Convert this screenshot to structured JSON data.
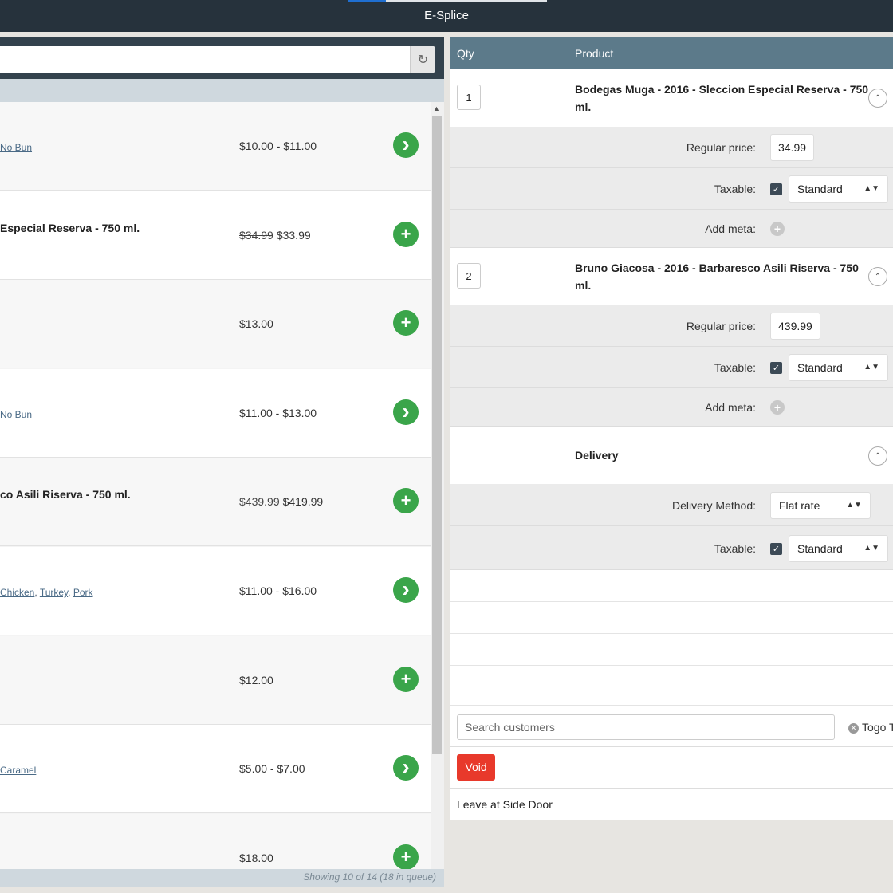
{
  "app": {
    "title": "E-Splice"
  },
  "products": {
    "rows": [
      {
        "name": "",
        "variants": [
          "No Bun"
        ],
        "price": "$10.00 - $11.00",
        "old_price": "",
        "action": "view"
      },
      {
        "name": "Especial Reserva - 750 ml.",
        "variants": [],
        "price": "$33.99",
        "old_price": "$34.99",
        "action": "add"
      },
      {
        "name": "",
        "variants": [],
        "price": "$13.00",
        "old_price": "",
        "action": "add"
      },
      {
        "name": "",
        "variants": [
          "No Bun"
        ],
        "price": "$11.00 - $13.00",
        "old_price": "",
        "action": "view"
      },
      {
        "name": "co Asili Riserva - 750 ml.",
        "variants": [],
        "price": "$419.99",
        "old_price": "$439.99",
        "action": "add"
      },
      {
        "name": "",
        "variants": [
          "Chicken",
          "Turkey",
          "Pork"
        ],
        "price": "$11.00 - $16.00",
        "old_price": "",
        "action": "view"
      },
      {
        "name": "",
        "variants": [],
        "price": "$12.00",
        "old_price": "",
        "action": "add"
      },
      {
        "name": "",
        "variants": [
          "Caramel"
        ],
        "price": "$5.00 - $7.00",
        "old_price": "",
        "action": "view"
      },
      {
        "name": "",
        "variants": [],
        "price": "$18.00",
        "old_price": "",
        "action": "add"
      }
    ],
    "footer": "Showing 10 of 14 (18 in queue)"
  },
  "cart": {
    "headers": {
      "qty": "Qty",
      "product": "Product"
    },
    "items": [
      {
        "qty": "1",
        "name": "Bodegas Muga - 2016 - Sleccion Especial Reserva - 750 ml.",
        "regular_price_label": "Regular price:",
        "regular_price": "34.99",
        "taxable_label": "Taxable:",
        "tax_class": "Standard",
        "add_meta_label": "Add meta:"
      },
      {
        "qty": "2",
        "name": "Bruno Giacosa - 2016 - Barbaresco Asili Riserva - 750 ml.",
        "regular_price_label": "Regular price:",
        "regular_price": "439.99",
        "taxable_label": "Taxable:",
        "tax_class": "Standard",
        "add_meta_label": "Add meta:"
      }
    ],
    "delivery": {
      "title": "Delivery",
      "method_label": "Delivery Method:",
      "method": "Flat rate",
      "taxable_label": "Taxable:",
      "tax_class": "Standard"
    },
    "customer_search_placeholder": "Search customers",
    "customer_tag": "Togo T",
    "void_label": "Void",
    "note": "Leave at Side Door"
  },
  "colors": {
    "topbar": "#26323c",
    "cart_header": "#5c7a8a",
    "action_green": "#3aa54a",
    "void_red": "#e8392b"
  }
}
